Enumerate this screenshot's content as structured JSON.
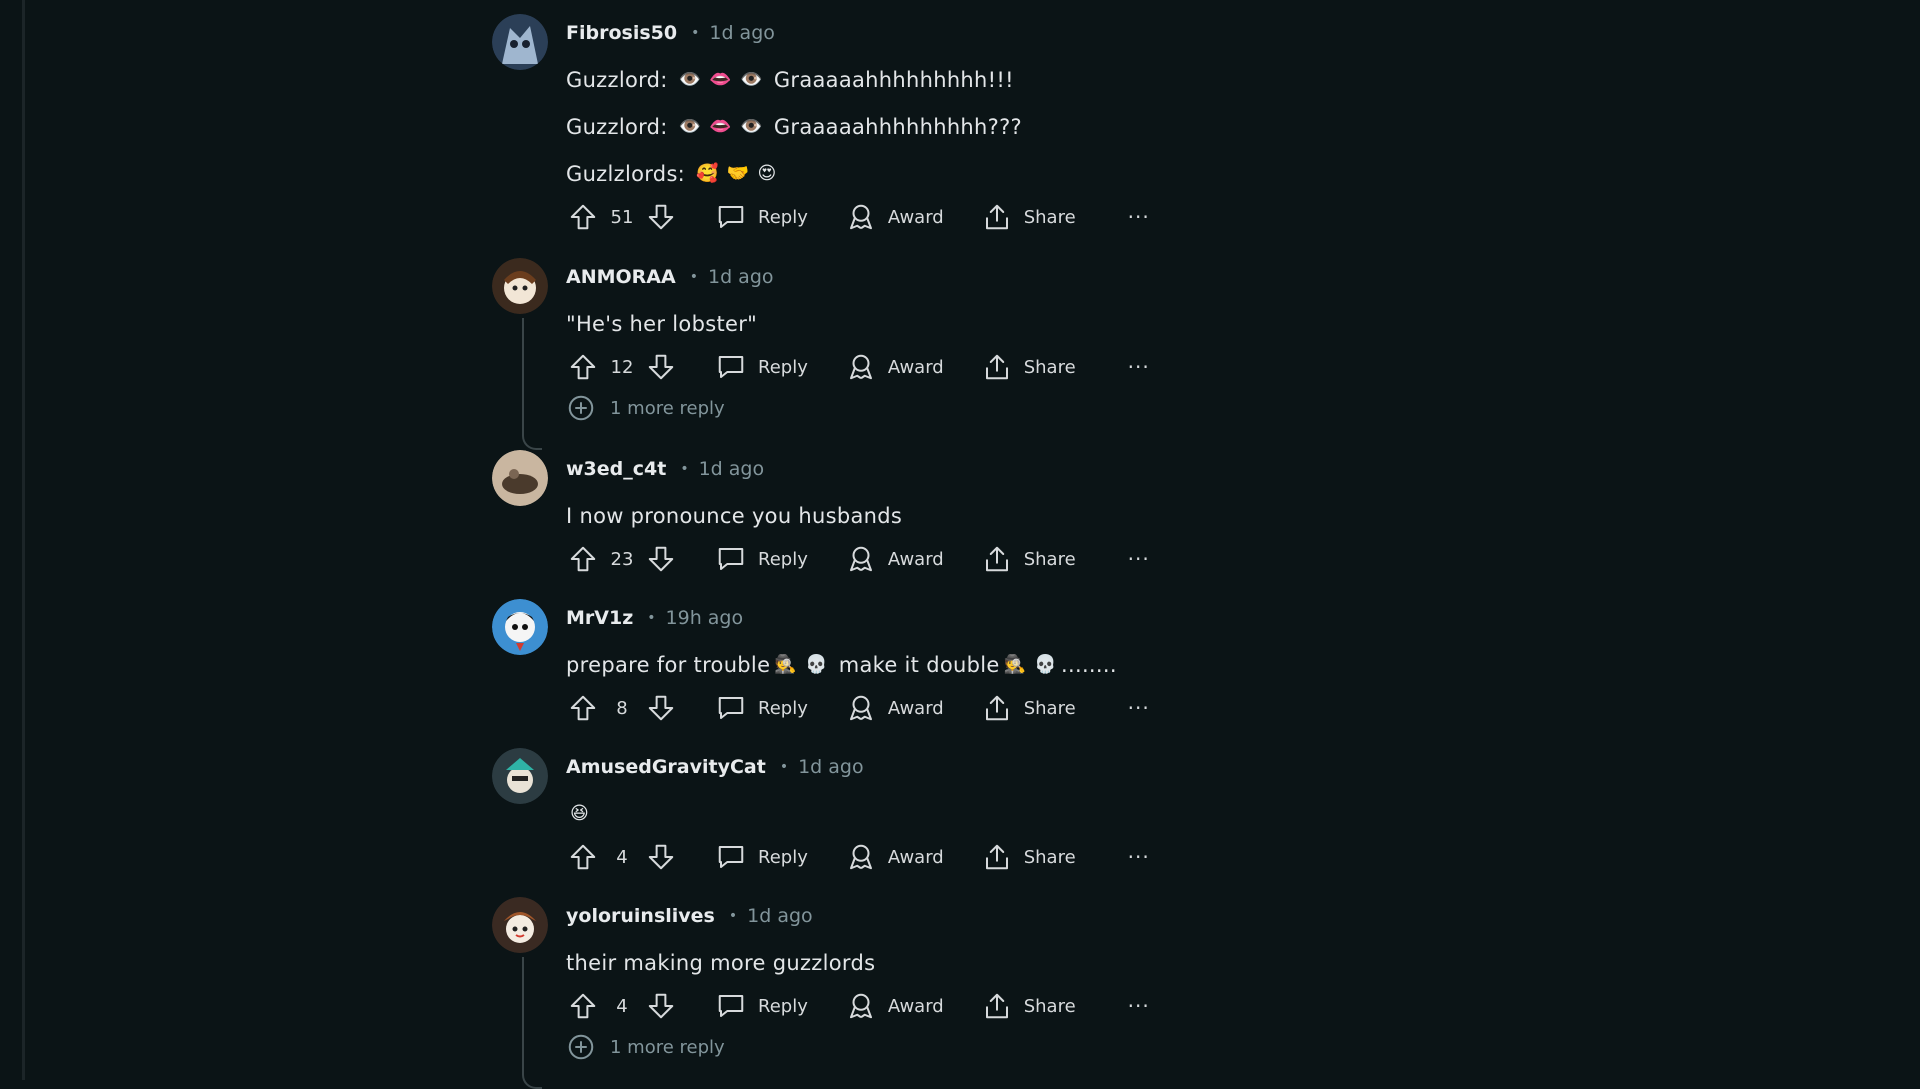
{
  "labels": {
    "reply": "Reply",
    "award": "Award",
    "share": "Share",
    "more": "···"
  },
  "comments": [
    {
      "author": "Fibrosis50",
      "time": "1d ago",
      "lines": [
        {
          "prefix": "Guzzlord:",
          "emojis": [
            "👁️",
            "👄",
            "👁️"
          ],
          "suffix": "Graaaaahhhhhhhhh!!!"
        },
        {
          "prefix": "Guzzlord:",
          "emojis": [
            "👁️",
            "👄",
            "👁️"
          ],
          "suffix": "Graaaaahhhhhhhhh???"
        },
        {
          "prefix": "Guzlzlords:",
          "emojis": [
            "🥰",
            "🤝",
            "😍"
          ],
          "suffix": ""
        }
      ],
      "score": "51"
    },
    {
      "author": "ANMORAA",
      "time": "1d ago",
      "text": "\"He's her lobster\"",
      "score": "12",
      "more_replies": "1 more reply"
    },
    {
      "author": "w3ed_c4t",
      "time": "1d ago",
      "text": "I now pronounce you husbands",
      "score": "23"
    },
    {
      "author": "MrV1z",
      "time": "19h ago",
      "text_parts": [
        "prepare for trouble",
        "🕵️",
        "💀",
        "make it double",
        "🕵️",
        "💀",
        "........"
      ],
      "score": "8"
    },
    {
      "author": "AmusedGravityCat",
      "time": "1d ago",
      "emoji": "😆",
      "score": "4"
    },
    {
      "author": "yoloruinslives",
      "time": "1d ago",
      "text": "their making more guzzlords",
      "score": "4",
      "more_replies": "1 more reply"
    }
  ]
}
